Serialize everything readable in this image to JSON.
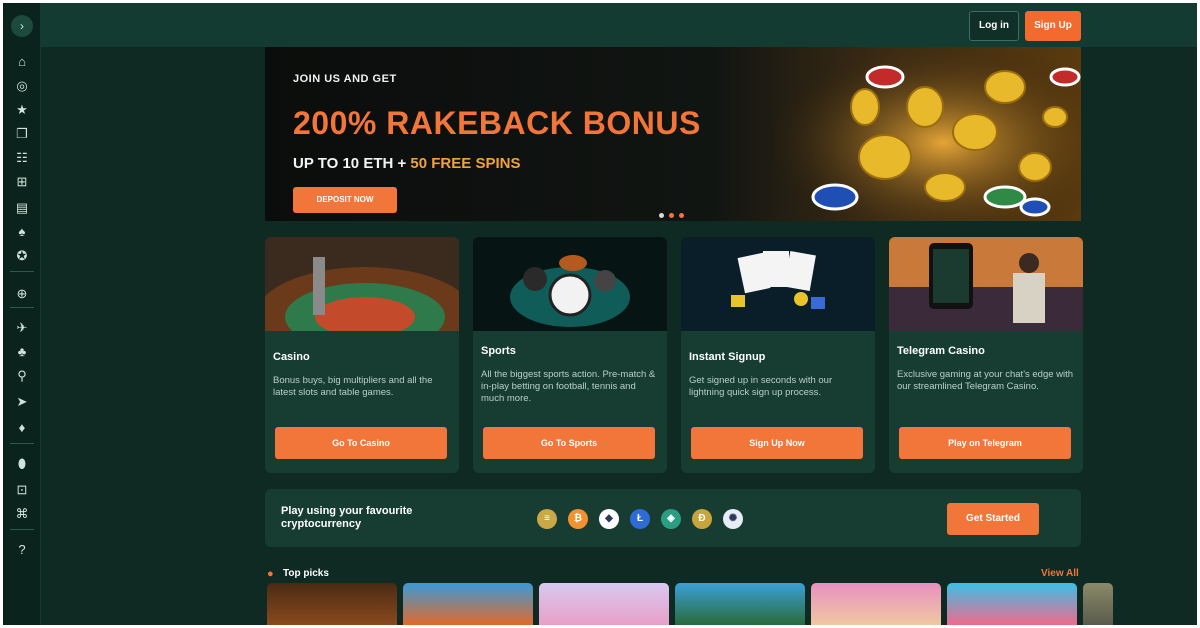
{
  "sidebar": {
    "toggle_icon": "›",
    "items": [
      {
        "name": "home-icon",
        "glyph": "⌂"
      },
      {
        "name": "chip-icon",
        "glyph": "◎"
      },
      {
        "name": "star-icon",
        "glyph": "★"
      },
      {
        "name": "cube-icon",
        "glyph": "❐"
      },
      {
        "name": "users-icon",
        "glyph": "☷"
      },
      {
        "name": "gift-icon",
        "glyph": "⊞"
      },
      {
        "name": "cards-icon",
        "glyph": "▤"
      },
      {
        "name": "spade-icon",
        "glyph": "♠"
      },
      {
        "name": "badge-icon",
        "glyph": "✪"
      },
      {
        "name": "sports-ball-icon",
        "glyph": "⊕"
      },
      {
        "name": "runner-icon",
        "glyph": "✈"
      },
      {
        "name": "tennis-icon",
        "glyph": "♣"
      },
      {
        "name": "search-icon",
        "glyph": "⚲"
      },
      {
        "name": "telegram-icon",
        "glyph": "➤"
      },
      {
        "name": "community-icon",
        "glyph": "♦"
      },
      {
        "name": "shield-icon",
        "glyph": "⬮"
      },
      {
        "name": "lock-icon",
        "glyph": "⊡"
      },
      {
        "name": "network-icon",
        "glyph": "⌘"
      },
      {
        "name": "help-icon",
        "glyph": "?"
      }
    ]
  },
  "header": {
    "login_label": "Log in",
    "signup_label": "Sign Up"
  },
  "banner": {
    "kicker": "JOIN US AND GET",
    "title": "200% RAKEBACK BONUS",
    "subtitle_prefix": "UP TO 10 ETH + ",
    "subtitle_highlight": "50 FREE SPINS",
    "cta_label": "DEPOSIT NOW",
    "dots": 3
  },
  "cards": [
    {
      "title": "Casino",
      "description": "Bonus buys, big multipliers and all the latest slots and table games.",
      "button": "Go To Casino"
    },
    {
      "title": "Sports",
      "description": "All the biggest sports action. Pre-match & in-play betting on football, tennis and much more.",
      "button": "Go To Sports"
    },
    {
      "title": "Instant Signup",
      "description": "Get signed up in seconds with our lightning quick sign up process.",
      "button": "Sign Up Now"
    },
    {
      "title": "Telegram Casino",
      "description": "Exclusive gaming at your chat's edge with our streamlined Telegram Casino.",
      "button": "Play on Telegram"
    }
  ],
  "crypto": {
    "text": "Play using your favourite cryptocurrency",
    "button": "Get Started",
    "coins": [
      {
        "name": "gold-coin-icon",
        "glyph": "≡",
        "color": "#c9a845"
      },
      {
        "name": "bitcoin-icon",
        "glyph": "₿",
        "color": "#f2922e"
      },
      {
        "name": "ethereum-icon",
        "glyph": "◆",
        "color": "#ffffff"
      },
      {
        "name": "litecoin-icon",
        "glyph": "Ł",
        "color": "#2f6bd6"
      },
      {
        "name": "tether-icon",
        "glyph": "◈",
        "color": "#2a9d82"
      },
      {
        "name": "dogecoin-icon",
        "glyph": "Ð",
        "color": "#c8a43c"
      },
      {
        "name": "cardano-icon",
        "glyph": "✺",
        "color": "#e8ecf4"
      }
    ]
  },
  "top_picks": {
    "title": "Top picks",
    "view_all": "View All"
  }
}
